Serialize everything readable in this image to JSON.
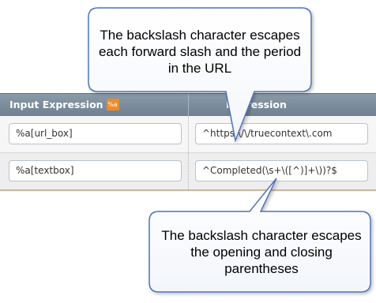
{
  "table": {
    "header": {
      "left_label": "Input Expression",
      "badge_label": "%a",
      "right_label": "Expression"
    },
    "rows": [
      {
        "input": "%a[url_box]",
        "expression": "^https:\\/\\/truecontext\\.com"
      },
      {
        "input": "%a[textbox]",
        "expression": "^Completed(\\s+\\([^)]+\\))?$"
      }
    ]
  },
  "callouts": {
    "top": "The backslash character escapes each forward slash and the period in the URL",
    "bottom": "The backslash character escapes the opening and closing parentheses"
  },
  "colors": {
    "header_bg": "#7a8a9a",
    "badge": "#f08a24",
    "callout_border": "#4f74b8"
  }
}
